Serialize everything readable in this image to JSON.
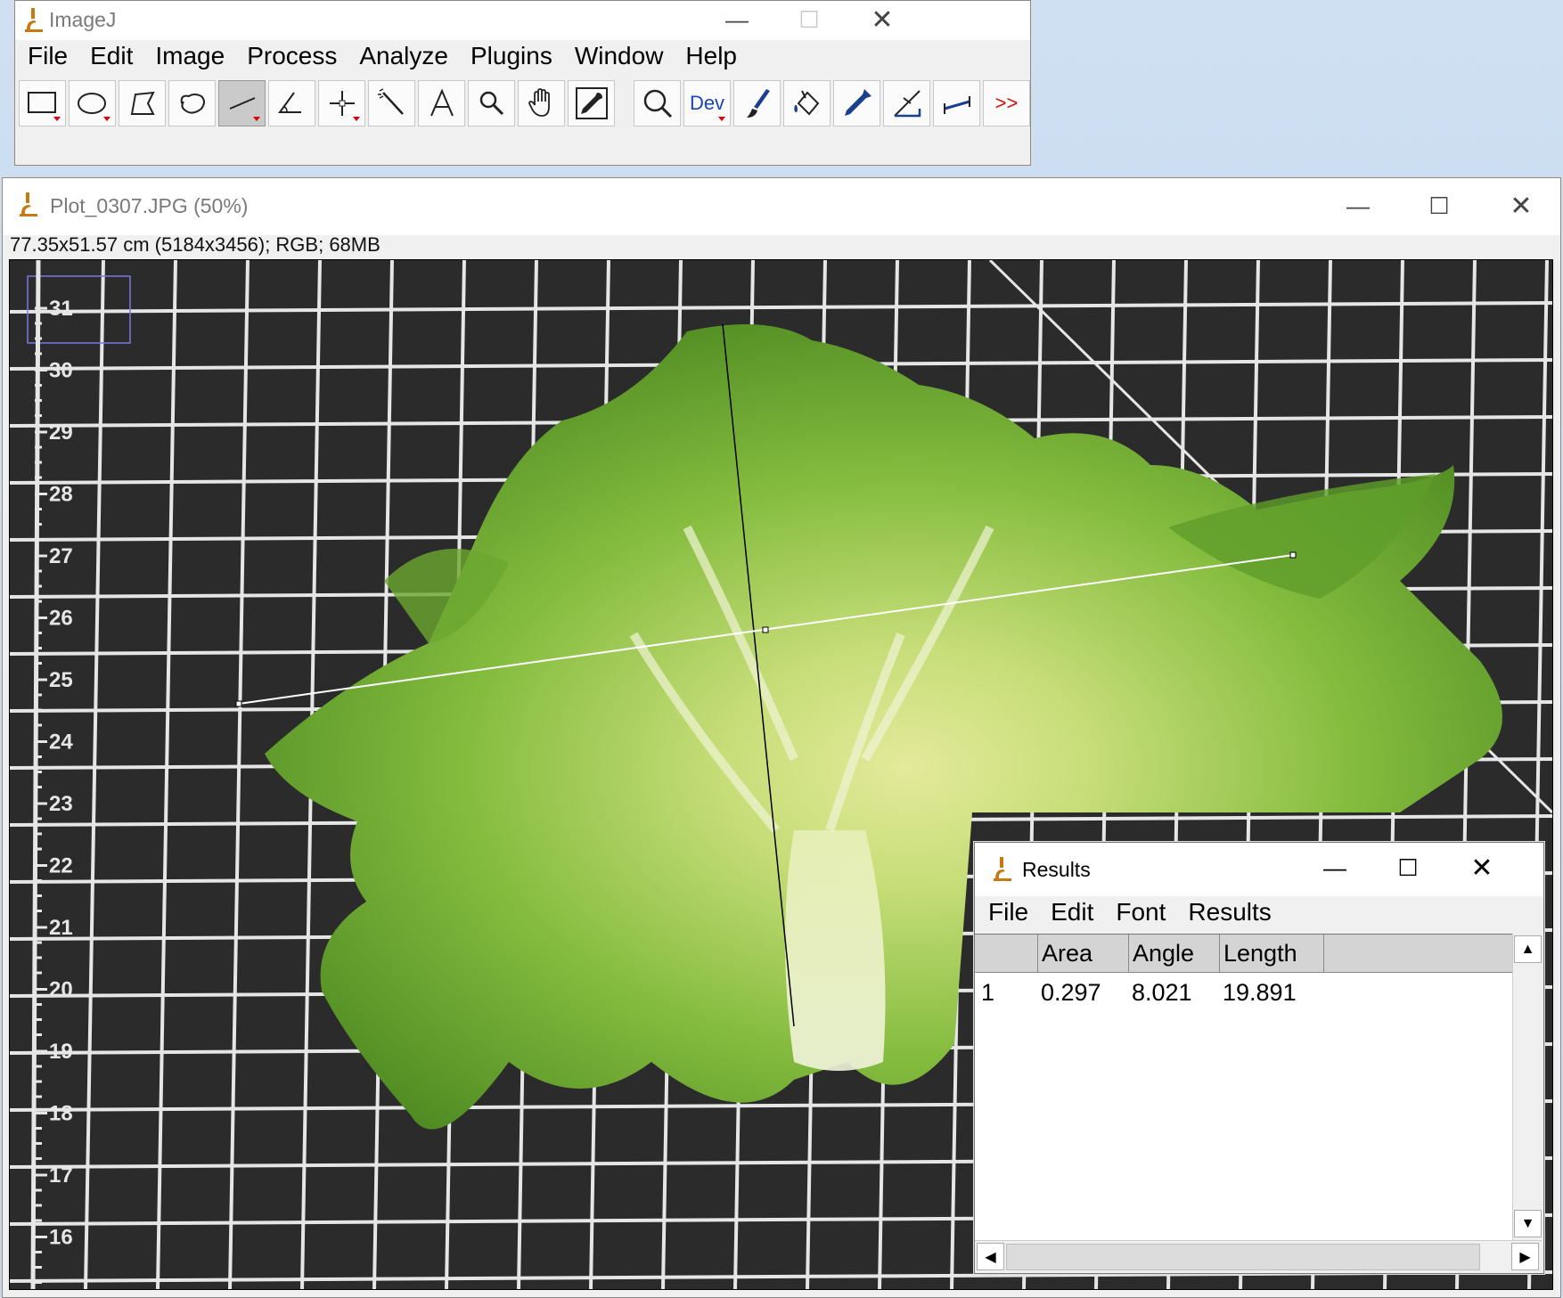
{
  "imagej_window": {
    "title": "ImageJ",
    "menu": [
      "File",
      "Edit",
      "Image",
      "Process",
      "Analyze",
      "Plugins",
      "Window",
      "Help"
    ],
    "dev_label": "Dev",
    "more_label": ">>"
  },
  "image_window": {
    "title": "Plot_0307.JPG (50%)",
    "info": "77.35x51.57 cm (5184x3456); RGB; 68MB",
    "ruler_labels": [
      "31",
      "30",
      "29",
      "28",
      "27",
      "26",
      "25",
      "24",
      "23",
      "22",
      "21",
      "20",
      "19",
      "18",
      "17",
      "16"
    ]
  },
  "results_window": {
    "title": "Results",
    "menu": [
      "File",
      "Edit",
      "Font",
      "Results"
    ],
    "columns": [
      "",
      "Area",
      "Angle",
      "Length"
    ],
    "rows": [
      {
        "index": "1",
        "area": "0.297",
        "angle": "8.021",
        "length": "19.891"
      }
    ]
  },
  "colors": {
    "board": "#2b2b2b",
    "grid": "#e6e6e6",
    "lettuce_dark": "#5c9a2a",
    "lettuce_light": "#c8e07a",
    "selection": "#ffffff"
  }
}
